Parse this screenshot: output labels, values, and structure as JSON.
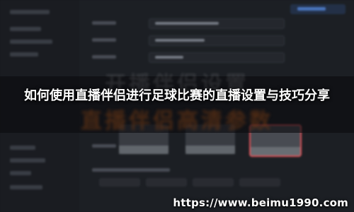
{
  "banner": {
    "headline": "如何使用直播伴侣进行足球比赛的直播设置与技巧分享",
    "background_text_top": "开播伴侣设置",
    "background_text_bottom": "直播伴侣高清参数"
  },
  "watermark": {
    "url": "https://www.beimu1990.com"
  },
  "colors": {
    "background": "#17191d",
    "sidebar": "#1b1d22",
    "accent_blue": "#4c79c4",
    "selected_red": "#e6545a",
    "headline_text": "#ffffff"
  }
}
